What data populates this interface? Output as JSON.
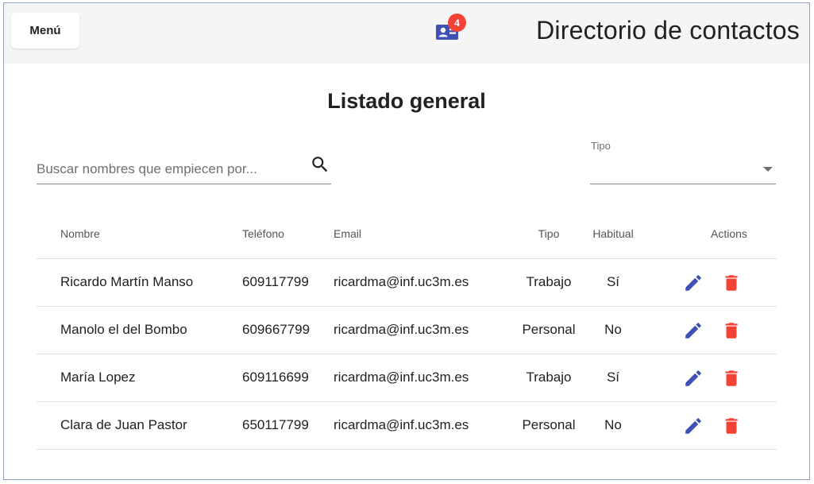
{
  "header": {
    "menu_label": "Menú",
    "contacts_badge": "4",
    "app_title": "Directorio de contactos"
  },
  "main": {
    "section_title": "Listado general",
    "search": {
      "placeholder": "Buscar nombres que empiecen por...",
      "value": ""
    },
    "type_filter": {
      "label": "Tipo",
      "value": ""
    }
  },
  "table": {
    "headers": {
      "name": "Nombre",
      "phone": "Teléfono",
      "email": "Email",
      "type": "Tipo",
      "habitual": "Habitual",
      "actions": "Actions"
    },
    "rows": [
      {
        "name": "Ricardo Martín Manso",
        "phone": "609117799",
        "email": "ricardma@inf.uc3m.es",
        "type": "Trabajo",
        "habitual": "Sí"
      },
      {
        "name": "Manolo el del Bombo",
        "phone": "609667799",
        "email": "ricardma@inf.uc3m.es",
        "type": "Personal",
        "habitual": "No"
      },
      {
        "name": "María Lopez",
        "phone": "609116699",
        "email": "ricardma@inf.uc3m.es",
        "type": "Trabajo",
        "habitual": "Sí"
      },
      {
        "name": "Clara de Juan Pastor",
        "phone": "650117799",
        "email": "ricardma@inf.uc3m.es",
        "type": "Personal",
        "habitual": "No"
      }
    ]
  },
  "icons": {
    "contacts": "contact-card-icon",
    "search": "search-icon",
    "dropdown": "arrow-drop-down-icon",
    "edit": "pencil-icon",
    "delete": "trash-icon"
  },
  "colors": {
    "primary": "#3f51b5",
    "warn": "#f44336",
    "topbar_bg": "#f5f5f5"
  }
}
